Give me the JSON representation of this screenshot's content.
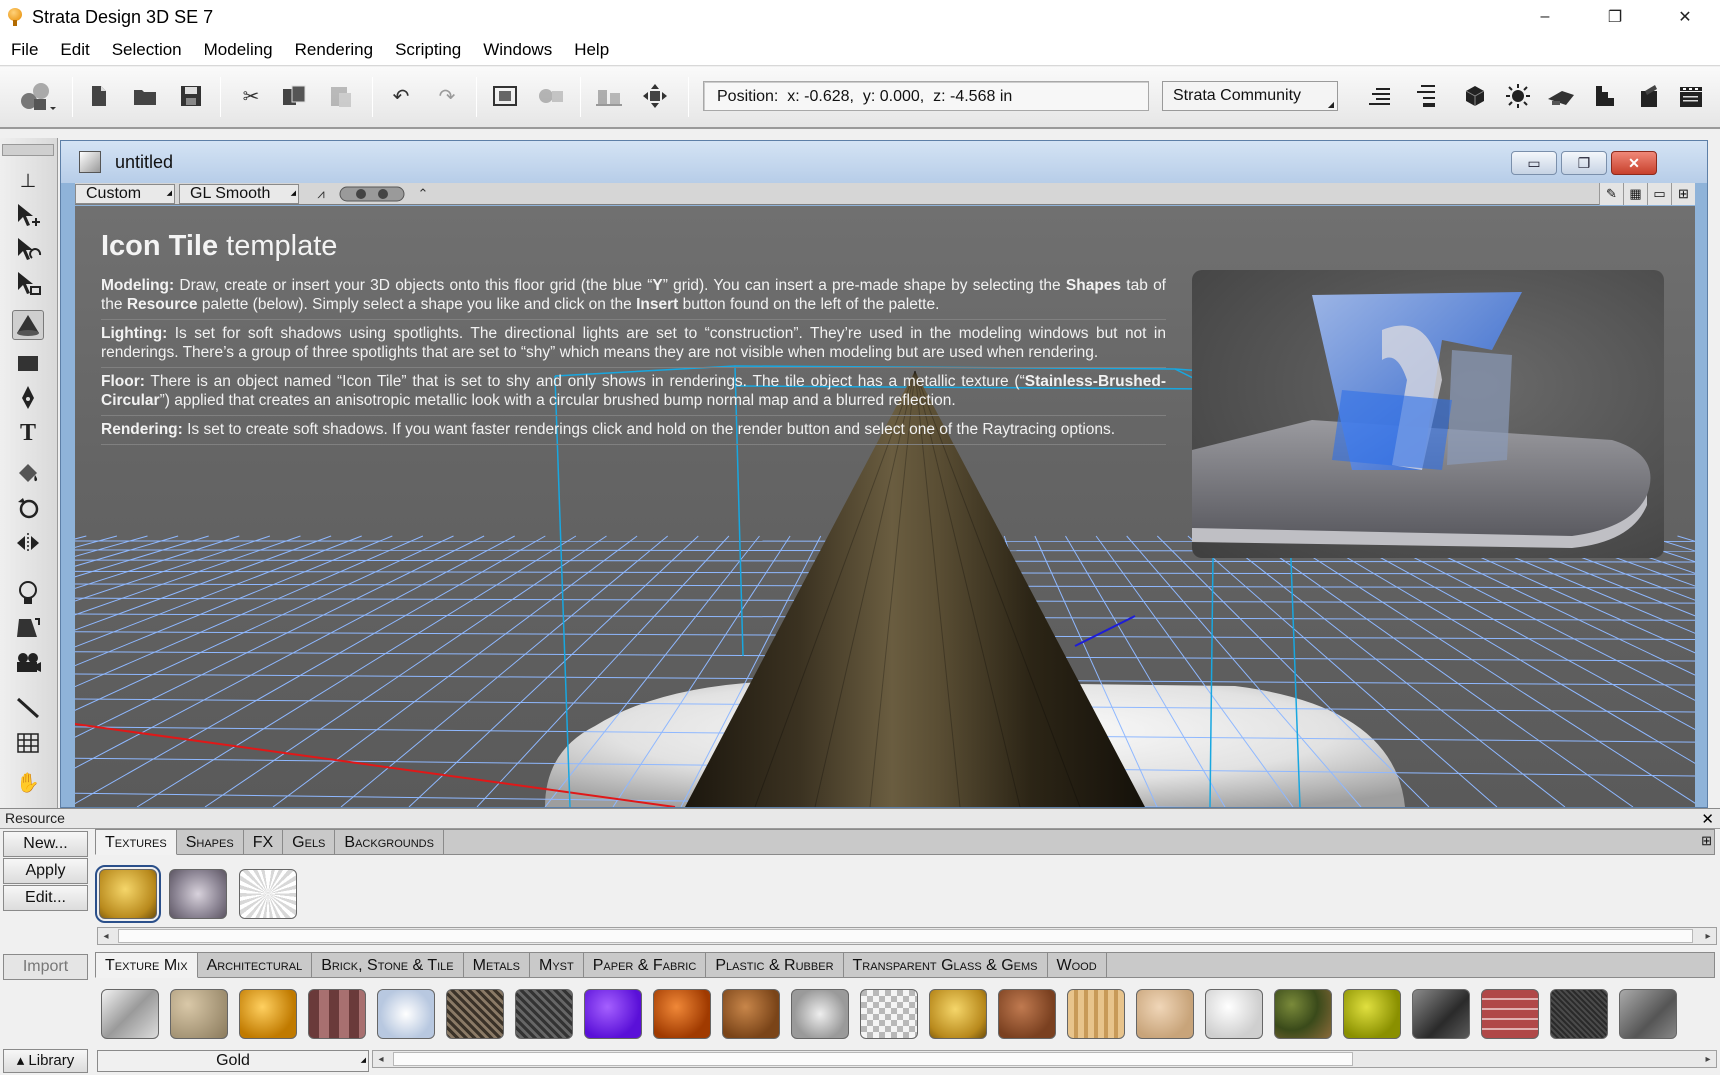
{
  "window": {
    "title": "Strata Design 3D SE 7",
    "controls": [
      "–",
      "❐",
      "✕"
    ]
  },
  "menu": [
    "File",
    "Edit",
    "Selection",
    "Modeling",
    "Rendering",
    "Scripting",
    "Windows",
    "Help"
  ],
  "toolbar": {
    "position_readout": "Position:  x: -0.628,  y: 0.000,  z: -4.568 in",
    "profile_dropdown": "Strata Community"
  },
  "document": {
    "title": "untitled",
    "view_mode": "Custom",
    "render_mode": "GL Smooth"
  },
  "template_panel": {
    "heading_bold": "Icon Tile",
    "heading_rest": " template",
    "paragraphs": [
      {
        "label": "Modeling:",
        "segments": [
          {
            "t": "  Draw, create or insert your 3D objects onto this floor grid (the blue “",
            "b": false
          },
          {
            "t": "Y",
            "b": true
          },
          {
            "t": "” grid). You can insert a pre-made shape by selecting the ",
            "b": false
          },
          {
            "t": "Shapes",
            "b": true
          },
          {
            "t": " tab of the ",
            "b": false
          },
          {
            "t": "Resource",
            "b": true
          },
          {
            "t": " palette (below). Simply select a shape you like and click on the ",
            "b": false
          },
          {
            "t": "Insert",
            "b": true
          },
          {
            "t": " button found on the left of the palette.",
            "b": false
          }
        ]
      },
      {
        "label": "Lighting:",
        "segments": [
          {
            "t": "  Is set for soft shadows using spotlights. The directional lights are set to “construction”. They’re used in the modeling windows but not in renderings. There’s a group of three spotlights that are set to “shy” which means they are not visible when modeling but are used when rendering.",
            "b": false
          }
        ]
      },
      {
        "label": "Floor:",
        "segments": [
          {
            "t": "  There is an object named “Icon Tile” that is set to shy and only shows in renderings. The tile object has a metallic texture (“",
            "b": false
          },
          {
            "t": "Stainless-Brushed-Circular",
            "b": true
          },
          {
            "t": "”) applied that creates an anisotropic metallic look with a circular brushed bump normal map and a blurred reflection.",
            "b": false
          }
        ]
      },
      {
        "label": "Rendering:",
        "segments": [
          {
            "t": "  Is set to create soft shadows. If you want faster renderings click and hold on the render button and select one of the Raytracing options.",
            "b": false
          }
        ]
      }
    ]
  },
  "resource": {
    "title": "Resource",
    "buttons": {
      "new": "New...",
      "apply": "Apply",
      "edit": "Edit...",
      "import": "Import",
      "library": "▴ Library"
    },
    "top_tabs": [
      "Textures",
      "Shapes",
      "FX",
      "Gels",
      "Backgrounds"
    ],
    "active_top_tab": "Textures",
    "doc_textures": [
      "gold",
      "brushed-metal",
      "white-rays"
    ],
    "library_tabs": [
      "Texture Mix",
      "Architectural",
      "Brick, Stone & Tile",
      "Metals",
      "Myst",
      "Paper & Fabric",
      "Plastic & Rubber",
      "Transparent Glass & Gems",
      "Wood"
    ],
    "active_library_tab": "Texture Mix",
    "library_swatches": [
      "chrome",
      "stone",
      "amber",
      "brick-mosaic",
      "ice",
      "tweed",
      "dark-mesh",
      "purple",
      "orange",
      "cork",
      "hammered",
      "checker",
      "gold",
      "terracotta",
      "wood",
      "tan",
      "white",
      "camo",
      "lime",
      "dark-metal",
      "red-brick",
      "dark-weave",
      "gray-metal"
    ],
    "selected_library_name": "Gold"
  },
  "colors": {
    "grid_line": "#8fb8ff",
    "bbox_line": "#18a7e0",
    "x_axis": "#e01818",
    "z_axis": "#1d1dd8",
    "cone_dark": "#2a2418"
  }
}
